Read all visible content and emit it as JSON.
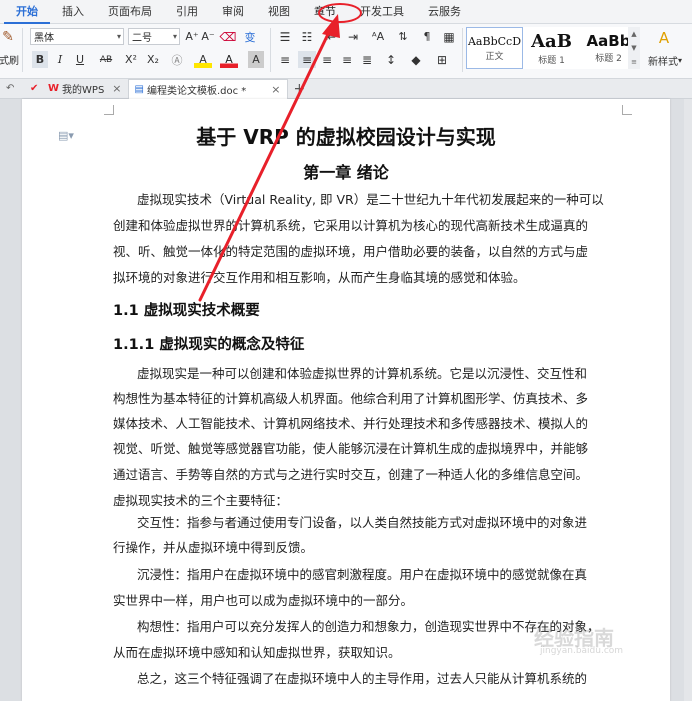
{
  "menu": {
    "tabs": [
      {
        "label": "开始"
      },
      {
        "label": "插入"
      },
      {
        "label": "页面布局"
      },
      {
        "label": "引用"
      },
      {
        "label": "审阅"
      },
      {
        "label": "视图"
      },
      {
        "label": "章节"
      },
      {
        "label": "开发工具"
      },
      {
        "label": "云服务"
      }
    ],
    "active_index": 0,
    "highlighted_index": 6
  },
  "ribbon": {
    "format_painter_label": "式刷",
    "font_name": "黑体",
    "font_size": "二号",
    "grow_font": "A⁺",
    "shrink_font": "A⁻",
    "bold": "B",
    "italic": "I",
    "underline": "U",
    "strike": "AB",
    "superscript": "X²",
    "subscript": "X₂",
    "font_color": "A",
    "highlight_color": "A",
    "char_border": "A",
    "phonetic": "变",
    "styles": [
      {
        "sample": "AaBbCcD",
        "name": "正文"
      },
      {
        "sample": "AaB",
        "name": "标题 1"
      },
      {
        "sample": "AaBb",
        "name": "标题 2"
      }
    ],
    "new_style_label": "新样式"
  },
  "doc_tabs": [
    {
      "label": "我的WPS"
    },
    {
      "label": "编程类论文模板.doc *"
    }
  ],
  "document": {
    "title": "基于 VRP 的虚拟校园设计与实现",
    "chapter": "第一章  绪论",
    "intro_lines": [
      "虚拟现实技术（Virtual Reality, 即 VR）是二十世纪九十年代初发展起来的一种可以",
      "创建和体验虚拟世界的计算机系统，它采用以计算机为核心的现代高新技术生成逼真的",
      "视、听、触觉一体化的特定范围的虚拟环境，用户借助必要的装备，以自然的方式与虚",
      "拟环境的对象进行交互作用和相互影响，从而产生身临其境的感觉和体验。"
    ],
    "section_1_1": "1.1  虚拟现实技术概要",
    "section_1_1_1": "1.1.1  虚拟现实的概念及特征",
    "body_lines": [
      "虚拟现实是一种可以创建和体验虚拟世界的计算机系统。它是以沉浸性、交互性和",
      "构想性为基本特征的计算机高级人机界面。他综合利用了计算机图形学、仿真技术、多",
      "媒体技术、人工智能技术、计算机网络技术、并行处理技术和多传感器技术、模拟人的",
      "视觉、听觉、触觉等感觉器官功能，使人能够沉浸在计算机生成的虚拟境界中，并能够",
      "通过语言、手势等自然的方式与之进行实时交互，创建了一种适人化的多维信息空间。",
      "虚拟现实技术的三个主要特征：",
      "交互性：指参与者通过使用专门设备，以人类自然技能方式对虚拟环境中的对象进",
      "行操作，并从虚拟环境中得到反馈。",
      "沉浸性：指用户在虚拟环境中的感官刺激程度。用户在虚拟环境中的感觉就像在真",
      "实世界中一样，用户也可以成为虚拟环境中的一部分。",
      "构想性：指用户可以充分发挥人的创造力和想象力，创造现实世界中不存在的对象，",
      "从而在虚拟环境中感知和认知虚拟世界，获取知识。",
      "总之，这三个特征强调了在虚拟环境中人的主导作用，过去人只能从计算机系统的"
    ]
  },
  "watermark": {
    "text": "经验指南",
    "sub": "jingyan.baidu.com"
  },
  "colors": {
    "accent": "#2b6fd6",
    "annotation": "#e8202a"
  }
}
